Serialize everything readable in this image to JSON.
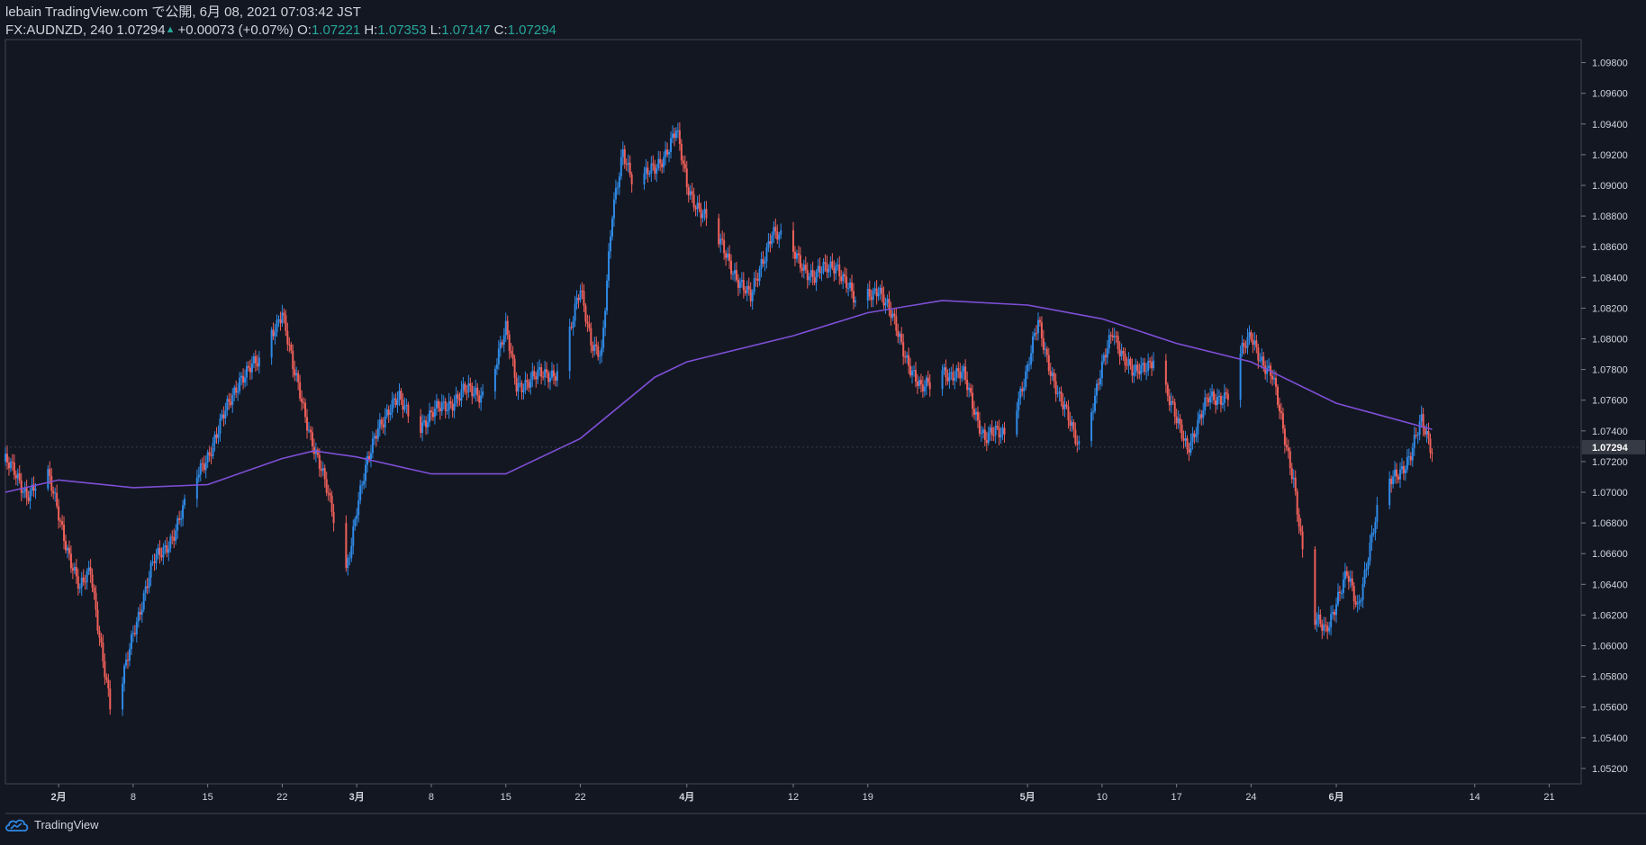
{
  "header": {
    "line1": "lebain TradingView.com で公開, 6月 08, 2021 07:03:42 JST",
    "symbol_line": "FX:AUDNZD, 240 1.07294",
    "change": "+0.00073 (+0.07%)",
    "o_label": "O:",
    "o_value": "1.07221",
    "h_label": "H:",
    "h_value": "1.07353",
    "l_label": "L:",
    "l_value": "1.07147",
    "c_label": "C:",
    "c_value": "1.07294"
  },
  "footer": {
    "brand": "TradingView",
    "icon": "tradingview-cloud-icon"
  },
  "colors": {
    "background": "#131722",
    "up": "#2f8ae6",
    "down": "#f0605a",
    "ma": "#7e4fd6",
    "grid": "#2a2e39",
    "text": "#d1d4dc",
    "change_up": "#26a69a",
    "last_price_bg": "#363a45"
  },
  "chart_data": {
    "type": "candlestick",
    "symbol": "FX:AUDNZD",
    "timeframe": "240",
    "ylim": [
      1.051,
      1.0995
    ],
    "y_ticks": [
      1.052,
      1.054,
      1.056,
      1.058,
      1.06,
      1.062,
      1.064,
      1.066,
      1.068,
      1.07,
      1.072,
      1.074,
      1.076,
      1.078,
      1.08,
      1.082,
      1.084,
      1.086,
      1.088,
      1.09,
      1.092,
      1.094,
      1.096,
      1.098
    ],
    "y_tick_labels": [
      "1.05200",
      "1.05400",
      "1.05600",
      "1.05800",
      "1.06000",
      "1.06200",
      "1.06400",
      "1.06600",
      "1.06800",
      "1.07000",
      "1.07200",
      "1.07400",
      "1.07600",
      "1.07800",
      "1.08000",
      "1.08200",
      "1.08400",
      "1.08600",
      "1.08800",
      "1.09000",
      "1.09200",
      "1.09400",
      "1.09600",
      "1.09800"
    ],
    "last_price": 1.07294,
    "last_price_label": "1.07294",
    "x_range": [
      "2021-01-27",
      "2021-06-24"
    ],
    "x_ticks": [
      {
        "date": "2021-02-01",
        "label": "2月"
      },
      {
        "date": "2021-02-08",
        "label": "8"
      },
      {
        "date": "2021-02-15",
        "label": "15"
      },
      {
        "date": "2021-02-22",
        "label": "22"
      },
      {
        "date": "2021-03-01",
        "label": "3月"
      },
      {
        "date": "2021-03-08",
        "label": "8"
      },
      {
        "date": "2021-03-15",
        "label": "15"
      },
      {
        "date": "2021-03-22",
        "label": "22"
      },
      {
        "date": "2021-04-01",
        "label": "4月"
      },
      {
        "date": "2021-04-11",
        "label": "12"
      },
      {
        "date": "2021-04-18",
        "label": "19"
      },
      {
        "date": "2021-05-03",
        "label": "5月"
      },
      {
        "date": "2021-05-10",
        "label": "10"
      },
      {
        "date": "2021-05-17",
        "label": "17"
      },
      {
        "date": "2021-05-24",
        "label": "24"
      },
      {
        "date": "2021-06-01",
        "label": "6月"
      },
      {
        "date": "2021-06-14",
        "label": "14"
      },
      {
        "date": "2021-06-21",
        "label": "21"
      }
    ],
    "close_series": [
      {
        "date": "2021-01-27",
        "close": 1.072
      },
      {
        "date": "2021-01-29",
        "close": 1.07
      },
      {
        "date": "2021-01-31",
        "close": 1.071
      },
      {
        "date": "2021-02-02",
        "close": 1.066
      },
      {
        "date": "2021-02-03",
        "close": 1.0635
      },
      {
        "date": "2021-02-04",
        "close": 1.065
      },
      {
        "date": "2021-02-05",
        "close": 1.06
      },
      {
        "date": "2021-02-06",
        "close": 1.055
      },
      {
        "date": "2021-02-07",
        "close": 1.0575
      },
      {
        "date": "2021-02-08",
        "close": 1.061
      },
      {
        "date": "2021-02-10",
        "close": 1.0655
      },
      {
        "date": "2021-02-12",
        "close": 1.0675
      },
      {
        "date": "2021-02-14",
        "close": 1.071
      },
      {
        "date": "2021-02-16",
        "close": 1.074
      },
      {
        "date": "2021-02-18",
        "close": 1.0775
      },
      {
        "date": "2021-02-20",
        "close": 1.0785
      },
      {
        "date": "2021-02-22",
        "close": 1.082
      },
      {
        "date": "2021-02-23",
        "close": 1.078
      },
      {
        "date": "2021-02-25",
        "close": 1.073
      },
      {
        "date": "2021-02-27",
        "close": 1.068
      },
      {
        "date": "2021-02-28",
        "close": 1.065
      },
      {
        "date": "2021-03-01",
        "close": 1.069
      },
      {
        "date": "2021-03-03",
        "close": 1.0745
      },
      {
        "date": "2021-03-05",
        "close": 1.076
      },
      {
        "date": "2021-03-07",
        "close": 1.0745
      },
      {
        "date": "2021-03-09",
        "close": 1.0755
      },
      {
        "date": "2021-03-11",
        "close": 1.0765
      },
      {
        "date": "2021-03-13",
        "close": 1.0765
      },
      {
        "date": "2021-03-15",
        "close": 1.0805
      },
      {
        "date": "2021-03-16",
        "close": 1.077
      },
      {
        "date": "2021-03-18",
        "close": 1.0775
      },
      {
        "date": "2021-03-20",
        "close": 1.078
      },
      {
        "date": "2021-03-22",
        "close": 1.083
      },
      {
        "date": "2021-03-23",
        "close": 1.08
      },
      {
        "date": "2021-03-24",
        "close": 1.079
      },
      {
        "date": "2021-03-25",
        "close": 1.088
      },
      {
        "date": "2021-03-26",
        "close": 1.0925
      },
      {
        "date": "2021-03-27",
        "close": 1.09
      },
      {
        "date": "2021-03-29",
        "close": 1.091
      },
      {
        "date": "2021-03-31",
        "close": 1.0935
      },
      {
        "date": "2021-04-01",
        "close": 1.09
      },
      {
        "date": "2021-04-03",
        "close": 1.0875
      },
      {
        "date": "2021-04-05",
        "close": 1.085
      },
      {
        "date": "2021-04-07",
        "close": 1.0825
      },
      {
        "date": "2021-04-08",
        "close": 1.085
      },
      {
        "date": "2021-04-09",
        "close": 1.087
      },
      {
        "date": "2021-04-11",
        "close": 1.0855
      },
      {
        "date": "2021-04-13",
        "close": 1.084
      },
      {
        "date": "2021-04-15",
        "close": 1.085
      },
      {
        "date": "2021-04-17",
        "close": 1.082
      },
      {
        "date": "2021-04-19",
        "close": 1.0835
      },
      {
        "date": "2021-04-21",
        "close": 1.08
      },
      {
        "date": "2021-04-23",
        "close": 1.0765
      },
      {
        "date": "2021-04-25",
        "close": 1.078
      },
      {
        "date": "2021-04-27",
        "close": 1.0775
      },
      {
        "date": "2021-04-29",
        "close": 1.0735
      },
      {
        "date": "2021-05-01",
        "close": 1.074
      },
      {
        "date": "2021-05-03",
        "close": 1.078
      },
      {
        "date": "2021-05-04",
        "close": 1.081
      },
      {
        "date": "2021-05-06",
        "close": 1.076
      },
      {
        "date": "2021-05-08",
        "close": 1.073
      },
      {
        "date": "2021-05-10",
        "close": 1.078
      },
      {
        "date": "2021-05-11",
        "close": 1.0805
      },
      {
        "date": "2021-05-13",
        "close": 1.0775
      },
      {
        "date": "2021-05-15",
        "close": 1.079
      },
      {
        "date": "2021-05-17",
        "close": 1.0745
      },
      {
        "date": "2021-05-18",
        "close": 1.073
      },
      {
        "date": "2021-05-20",
        "close": 1.076
      },
      {
        "date": "2021-05-22",
        "close": 1.0765
      },
      {
        "date": "2021-05-23",
        "close": 1.079
      },
      {
        "date": "2021-05-24",
        "close": 1.08
      },
      {
        "date": "2021-05-26",
        "close": 1.0775
      },
      {
        "date": "2021-05-27",
        "close": 1.074
      },
      {
        "date": "2021-05-28",
        "close": 1.071
      },
      {
        "date": "2021-05-29",
        "close": 1.065
      },
      {
        "date": "2021-05-30",
        "close": 1.0615
      },
      {
        "date": "2021-05-31",
        "close": 1.061
      },
      {
        "date": "2021-06-01",
        "close": 1.063
      },
      {
        "date": "2021-06-02",
        "close": 1.0645
      },
      {
        "date": "2021-06-03",
        "close": 1.0625
      },
      {
        "date": "2021-06-04",
        "close": 1.066
      },
      {
        "date": "2021-06-05",
        "close": 1.069
      },
      {
        "date": "2021-06-06",
        "close": 1.0705
      },
      {
        "date": "2021-06-07",
        "close": 1.0715
      },
      {
        "date": "2021-06-08",
        "close": 1.0725
      },
      {
        "date": "2021-06-09",
        "close": 1.0745
      },
      {
        "date": "2021-06-10",
        "close": 1.0729
      }
    ],
    "moving_average": [
      {
        "date": "2021-01-27",
        "value": 1.07
      },
      {
        "date": "2021-02-01",
        "value": 1.0708
      },
      {
        "date": "2021-02-08",
        "value": 1.0703
      },
      {
        "date": "2021-02-15",
        "value": 1.0705
      },
      {
        "date": "2021-02-22",
        "value": 1.0722
      },
      {
        "date": "2021-02-25",
        "value": 1.0727
      },
      {
        "date": "2021-03-01",
        "value": 1.0723
      },
      {
        "date": "2021-03-08",
        "value": 1.0712
      },
      {
        "date": "2021-03-15",
        "value": 1.0712
      },
      {
        "date": "2021-03-22",
        "value": 1.0735
      },
      {
        "date": "2021-03-29",
        "value": 1.0775
      },
      {
        "date": "2021-04-01",
        "value": 1.0785
      },
      {
        "date": "2021-04-11",
        "value": 1.0802
      },
      {
        "date": "2021-04-18",
        "value": 1.0817
      },
      {
        "date": "2021-04-25",
        "value": 1.0825
      },
      {
        "date": "2021-05-03",
        "value": 1.0822
      },
      {
        "date": "2021-05-10",
        "value": 1.0813
      },
      {
        "date": "2021-05-17",
        "value": 1.0797
      },
      {
        "date": "2021-05-24",
        "value": 1.0785
      },
      {
        "date": "2021-06-01",
        "value": 1.0758
      },
      {
        "date": "2021-06-10",
        "value": 1.0741
      }
    ]
  }
}
